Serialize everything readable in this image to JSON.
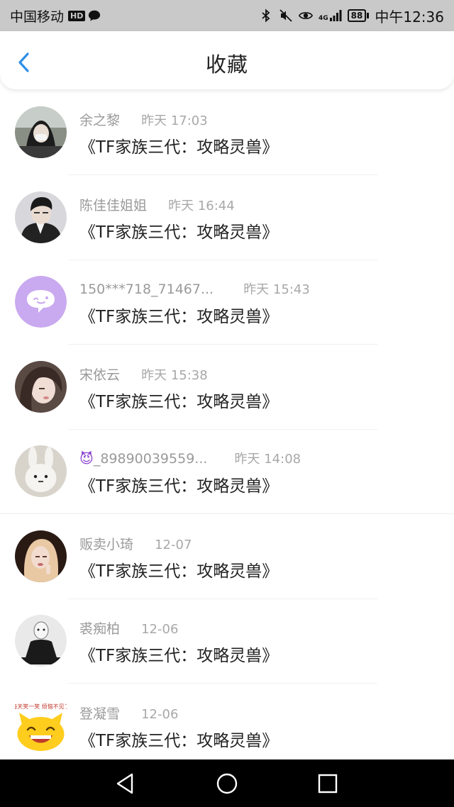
{
  "status_bar": {
    "carrier": "中国移动",
    "hd_badge": "HD",
    "network": "4G",
    "battery": "88",
    "time": "中午12:36"
  },
  "header": {
    "title": "收藏"
  },
  "favorites": [
    {
      "name": "余之黎",
      "time": "昨天 17:03",
      "content": "《TF家族三代：攻略灵兽》"
    },
    {
      "name": "陈佳佳姐姐",
      "time": "昨天 16:44",
      "content": "《TF家族三代：攻略灵兽》"
    },
    {
      "name": "150***718_71467...",
      "time": "昨天 15:43",
      "content": "《TF家族三代：攻略灵兽》"
    },
    {
      "name": "宋依云",
      "time": "昨天 15:38",
      "content": "《TF家族三代：攻略灵兽》"
    },
    {
      "name": "_89890039559...",
      "name_emoji": "😈",
      "time": "昨天 14:08",
      "content": "《TF家族三代：攻略灵兽》"
    },
    {
      "name": "贩卖小琦",
      "time": "12-07",
      "content": "《TF家族三代：攻略灵兽》"
    },
    {
      "name": "裘痴柏",
      "time": "12-06",
      "content": "《TF家族三代：攻略灵兽》"
    },
    {
      "name": "登凝雪",
      "time": "12-06",
      "content": "《TF家族三代：攻略灵兽》",
      "avatar_text": "每天笑一笑 烦恼不见了"
    }
  ],
  "colors": {
    "accent": "#2f8fe8",
    "default_avatar": "#c9a9ef"
  }
}
